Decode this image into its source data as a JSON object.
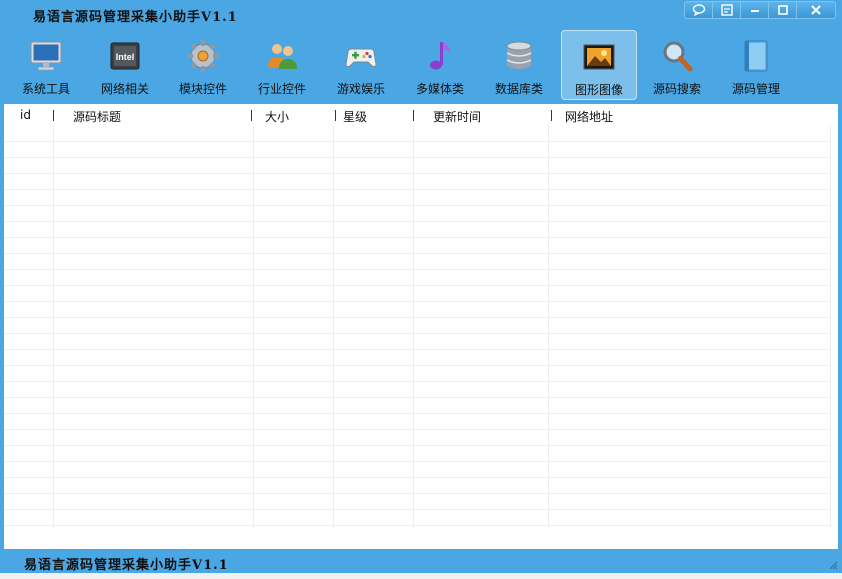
{
  "window": {
    "title": "易语言源码管理采集小助手V1.1",
    "accent": "#4ba7e3"
  },
  "toolbar": {
    "items": [
      {
        "label": "系统工具",
        "icon": "monitor-icon"
      },
      {
        "label": "网络相关",
        "icon": "chip-icon"
      },
      {
        "label": "模块控件",
        "icon": "gear-icon"
      },
      {
        "label": "行业控件",
        "icon": "users-icon"
      },
      {
        "label": "游戏娱乐",
        "icon": "gamepad-icon"
      },
      {
        "label": "多媒体类",
        "icon": "music-note-icon"
      },
      {
        "label": "数据库类",
        "icon": "database-icon"
      },
      {
        "label": "图形图像",
        "icon": "picture-icon",
        "active": true
      },
      {
        "label": "源码搜索",
        "icon": "magnifier-icon"
      },
      {
        "label": "源码管理",
        "icon": "book-icon"
      }
    ]
  },
  "list": {
    "columns": [
      "id",
      "源码标题",
      "大小",
      "星级",
      "更新时间",
      "网络地址"
    ],
    "rows": []
  },
  "statusbar": {
    "text": "易语言源码管理采集小助手V1.1"
  }
}
